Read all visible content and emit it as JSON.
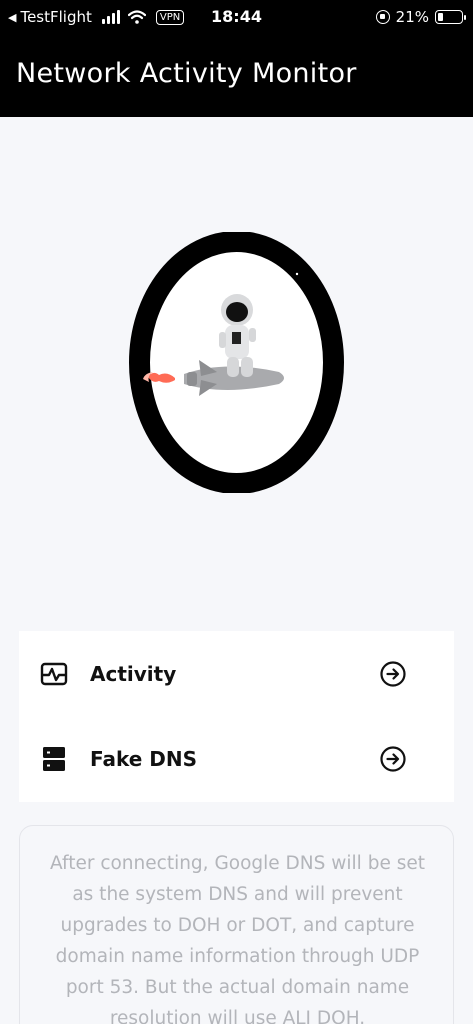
{
  "status_bar": {
    "back_app": "TestFlight",
    "vpn": "VPN",
    "time": "18:44",
    "battery_percent": "21%",
    "battery_level": 0.21
  },
  "header": {
    "title": "Network Activity Monitor"
  },
  "hero": {
    "image_name": "astronaut-riding-rocket-illustration"
  },
  "menu": {
    "items": [
      {
        "label": "Activity",
        "icon": "activity-pulse-icon"
      },
      {
        "label": "Fake DNS",
        "icon": "server-icon"
      }
    ]
  },
  "info": {
    "text": "After connecting, Google DNS will be set as the system DNS and will prevent upgrades to DOH or DOT, and capture domain name information through UDP port 53. But the actual domain name resolution will use ALI DOH."
  },
  "colors": {
    "header_bg": "#000000",
    "page_bg": "#f6f7fa",
    "card_bg": "#ffffff",
    "info_text": "#b3b5ba"
  }
}
